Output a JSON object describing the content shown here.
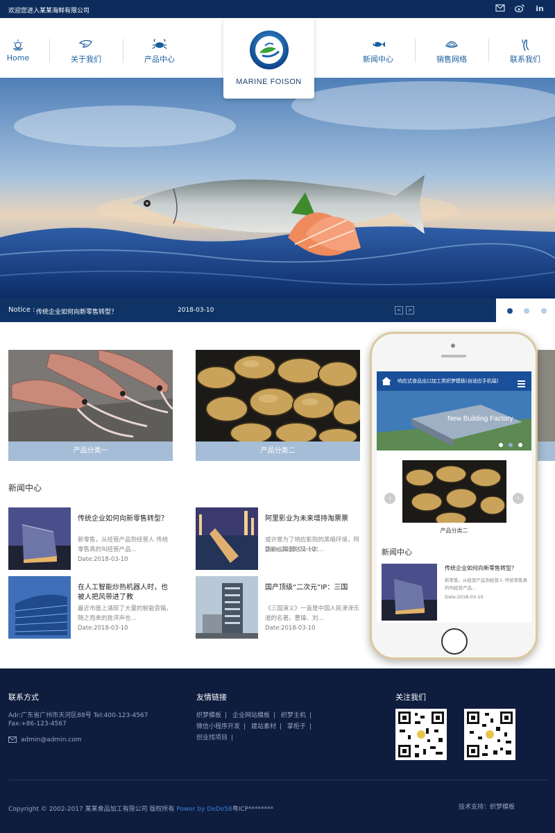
{
  "topbar": {
    "welcome": "欢迎您进入某某海鲜有限公司",
    "icons": [
      "mail-icon",
      "weibo-icon",
      "linkedin-icon"
    ]
  },
  "nav": {
    "home": "Home",
    "about": "关于我们",
    "products": "产品中心",
    "news": "新闻中心",
    "network": "销售网络",
    "contact": "联系我们",
    "brand": "MARINE FOISON"
  },
  "notice": {
    "label": "Notice :",
    "text": "传统企业如何向新零售转型？",
    "date": "2018-03-10",
    "prev": "<",
    "next": ">"
  },
  "categories": [
    {
      "label": "产品分类一"
    },
    {
      "label": "产品分类二"
    }
  ],
  "news_section": {
    "title": "新闻中心",
    "items": [
      {
        "title": "传统企业如何向新零售转型？",
        "desc": "新零售，从经营产品到经营人 传统零售真的叫经营产品...",
        "date": "Date:2018-03-10"
      },
      {
        "title": "阿里影业为未来增持淘票票",
        "desc": "或许是为了响应影院的黑暗环境，阿里影业集团总又一次...",
        "date": "Date:2018-03-10"
      },
      {
        "title": "在人工智能炒热机器人时，也被人把风带进了教",
        "desc": "最近市面上涌现了大量的智能音箱，随之而来的批评声也...",
        "date": "Date:2018-03-10"
      },
      {
        "title": "国产顶级“二次元”IP：三国",
        "desc": "《三国演义》一直是中国人民津津乐道的名著。曹操、刘...",
        "date": "Date:2018-03-10"
      }
    ]
  },
  "phone": {
    "header": "响应式食品出口加工类织梦模板(自适应手机端)",
    "banner": "New Building Factory",
    "category": "产品分类二",
    "news_title": "新闻中心",
    "news_item_title": "传统企业如何向新零售转型？",
    "news_item_desc": "新零售，从经营产品到经营人 传统零售真的叫经营产品...",
    "news_item_date": "Date:2018-03-10"
  },
  "footer": {
    "contact_title": "联系方式",
    "address": "Adr:广东省广州市天河区88号 Tel:400-123-4567",
    "fax": "Fax:+86-123-4567",
    "email": "admin@admin.com",
    "links_title": "友情链接",
    "links": [
      "织梦模板",
      "企业网站模板",
      "织梦主机",
      "微信小程序开发",
      "建站素材",
      "掌柜子",
      "创业找项目"
    ],
    "follow_title": "关注我们",
    "copyright": "Copyright © 2002-2017 某某食品加工有限公司 版权所有",
    "powered": "Power by DeDe58",
    "icp": "粤ICP********",
    "support": "技术支持：织梦模板"
  },
  "colors": {
    "topbar": "#0d2c5c",
    "nav_text": "#1a5e9e",
    "notice_bg": "#0e3364",
    "category_label": "#a5bdd6",
    "footer_bg": "#0e1c3e",
    "phone_header": "#1a4f9a"
  }
}
